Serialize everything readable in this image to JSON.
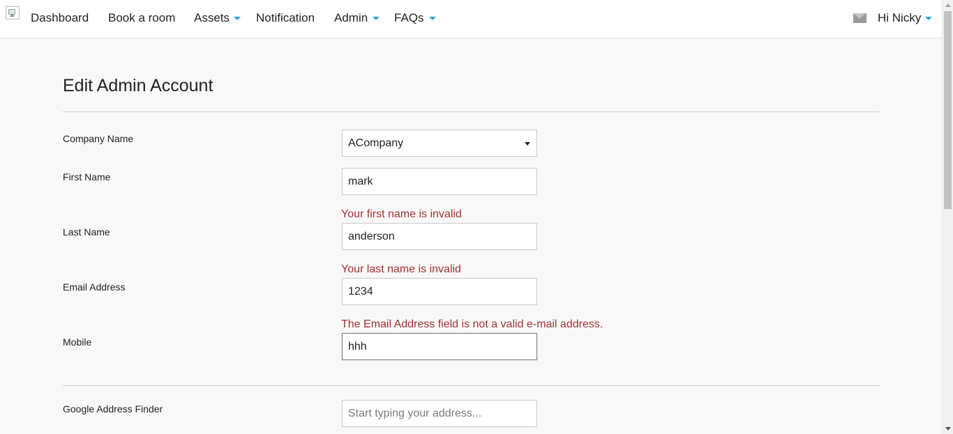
{
  "nav": {
    "items": [
      {
        "label": "Dashboard",
        "has_dropdown": false
      },
      {
        "label": "Book a room",
        "has_dropdown": false
      },
      {
        "label": "Assets",
        "has_dropdown": true
      },
      {
        "label": "Notification",
        "has_dropdown": false
      },
      {
        "label": "Admin",
        "has_dropdown": true
      },
      {
        "label": "FAQs",
        "has_dropdown": true
      }
    ],
    "user_greeting": "Hi Nicky",
    "mail_icon": "envelope-icon",
    "accent_color": "#2a9fd8"
  },
  "page": {
    "title": "Edit Admin Account"
  },
  "form": {
    "company_name": {
      "label": "Company Name",
      "value": "ACompany"
    },
    "first_name": {
      "label": "First Name",
      "value": "mark",
      "error": "Your first name is invalid"
    },
    "last_name": {
      "label": "Last Name",
      "value": "anderson",
      "error": "Your last name is invalid"
    },
    "email": {
      "label": "Email Address",
      "value": "1234",
      "error": "The Email Address field is not a valid e-mail address."
    },
    "mobile": {
      "label": "Mobile",
      "value": "hhh"
    },
    "address_finder": {
      "label": "Google Address Finder",
      "value": "",
      "placeholder": "Start typing your address..."
    }
  },
  "colors": {
    "error_text": "#a33232",
    "background": "#f8f8f8"
  }
}
